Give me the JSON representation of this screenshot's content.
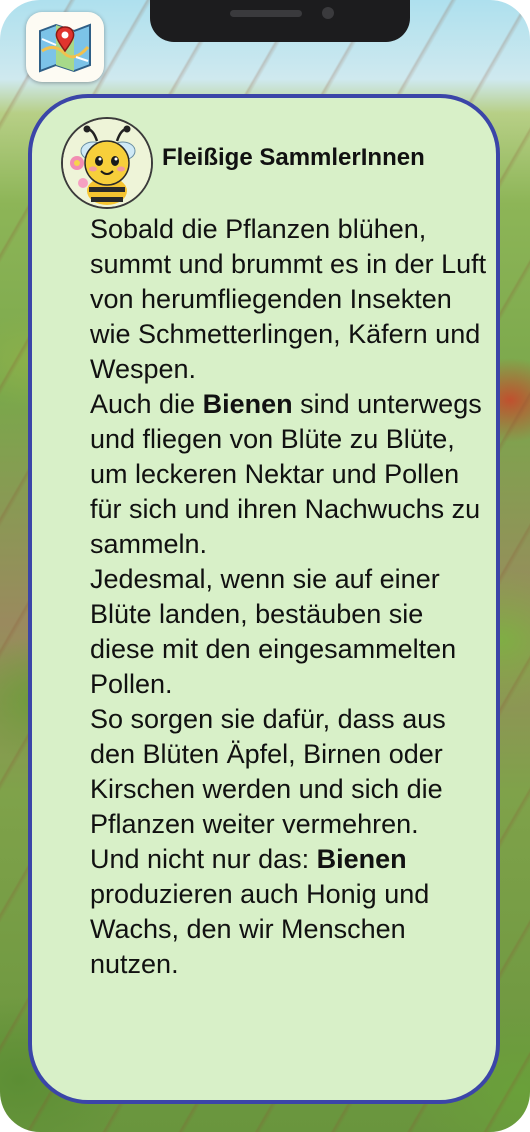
{
  "app": {
    "map_icon": "map-icon",
    "avatar_icon": "bee-avatar"
  },
  "card": {
    "title": "Fleißige SammlerInnen",
    "paragraphs": [
      {
        "parts": [
          {
            "text": "Sobald die Pflanzen blühen, summt und brummt es in der Luft von herumfliegenden Insekten wie Schmetterlingen, Käfern und Wespen."
          }
        ]
      },
      {
        "parts": [
          {
            "text": "Auch die "
          },
          {
            "text": "Bienen",
            "bold": true
          },
          {
            "text": " sind unterwegs und fliegen von Blüte zu Blüte, um leckeren Nektar und Pollen für sich und ihren Nachwuchs zu sammeln."
          }
        ]
      },
      {
        "parts": [
          {
            "text": "Jedesmal, wenn sie auf einer Blüte landen, bestäuben sie diese mit den eingesammelten Pollen."
          }
        ]
      },
      {
        "parts": [
          {
            "text": "So sorgen sie dafür, dass aus den Blüten Äpfel, Birnen oder Kirschen werden und sich die Pflanzen weiter vermehren."
          }
        ]
      },
      {
        "parts": [
          {
            "text": "Und nicht nur das: "
          },
          {
            "text": "Bienen",
            "bold": true
          },
          {
            "text": " produzieren auch Honig und Wachs, den wir Menschen nutzen."
          }
        ]
      }
    ]
  },
  "colors": {
    "card_background": "#d8f0c8",
    "card_border": "#3b45a8"
  }
}
